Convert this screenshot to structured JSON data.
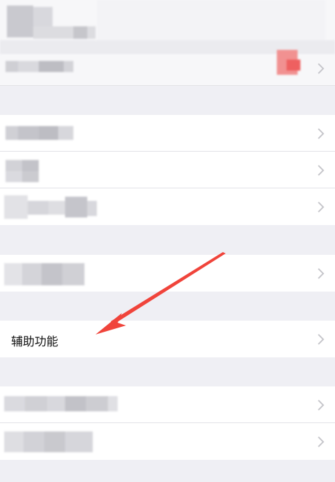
{
  "rows": {
    "accessibility_label": "辅助功能"
  },
  "icons": {
    "chevron": "chevron-right-icon"
  },
  "colors": {
    "background": "#efeff4",
    "row": "#ffffff",
    "chevron": "#c7c7cc",
    "annotation_arrow": "#f0443b",
    "badge": "#f06060"
  }
}
